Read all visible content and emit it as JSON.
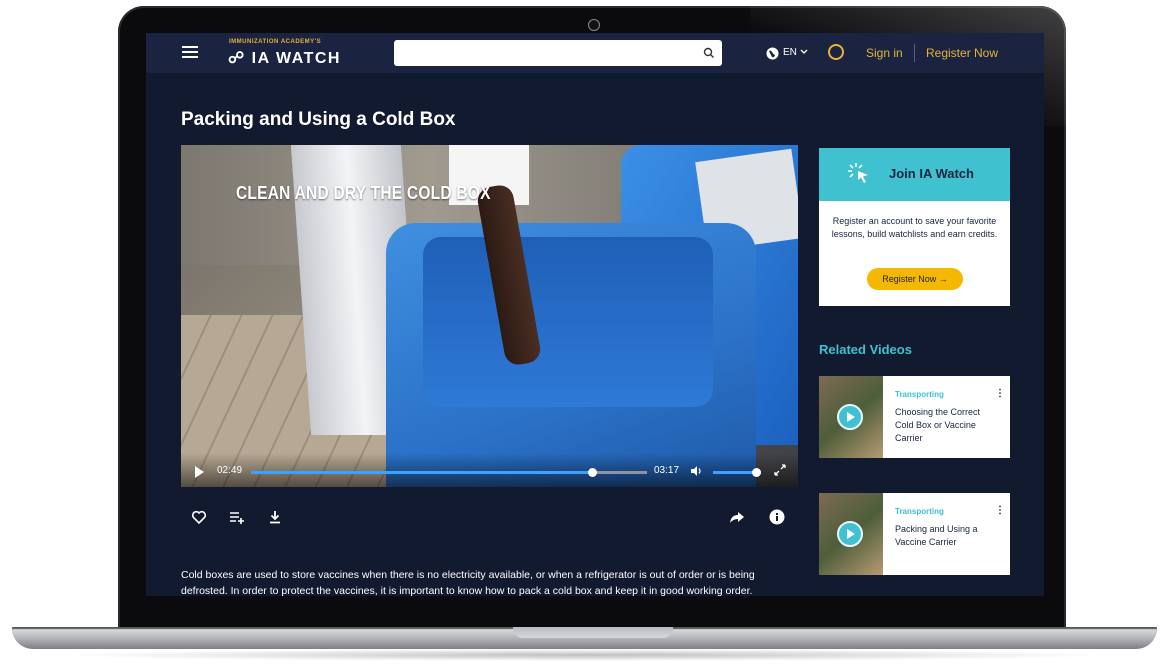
{
  "nav": {
    "logo_top": "IMMUNIZATION ACADEMY'S",
    "logo_main": "IA WATCH",
    "search_placeholder": "",
    "language": "EN",
    "signin": "Sign in",
    "register": "Register Now"
  },
  "page": {
    "title": "Packing and Using a Cold Box"
  },
  "video": {
    "caption": "CLEAN AND DRY THE COLD BOX",
    "current_time": "02:49",
    "total_time": "03:17",
    "progress": 0.86,
    "volume": 0.9
  },
  "description": "Cold boxes are used to store vaccines when there is no electricity available, or when a refrigerator is out of order or is being defrosted. In order to protect the vaccines, it is important to know how to pack a cold box and keep it in good working order.",
  "join": {
    "title": "Join IA Watch",
    "text": "Register an account to save your favorite lessons, build watchlists and earn credits.",
    "button": "Register Now →"
  },
  "related": {
    "title": "Related Videos",
    "items": [
      {
        "category": "Transporting",
        "name": "Choosing the Correct Cold Box or Vaccine Carrier"
      },
      {
        "category": "Transporting",
        "name": "Packing and Using a Vaccine Carrier"
      }
    ]
  },
  "colors": {
    "navy": "#1a2440",
    "accent_gold": "#e6b23a",
    "accent_teal": "#3fc1cf",
    "progress_blue": "#3ea1ff"
  }
}
